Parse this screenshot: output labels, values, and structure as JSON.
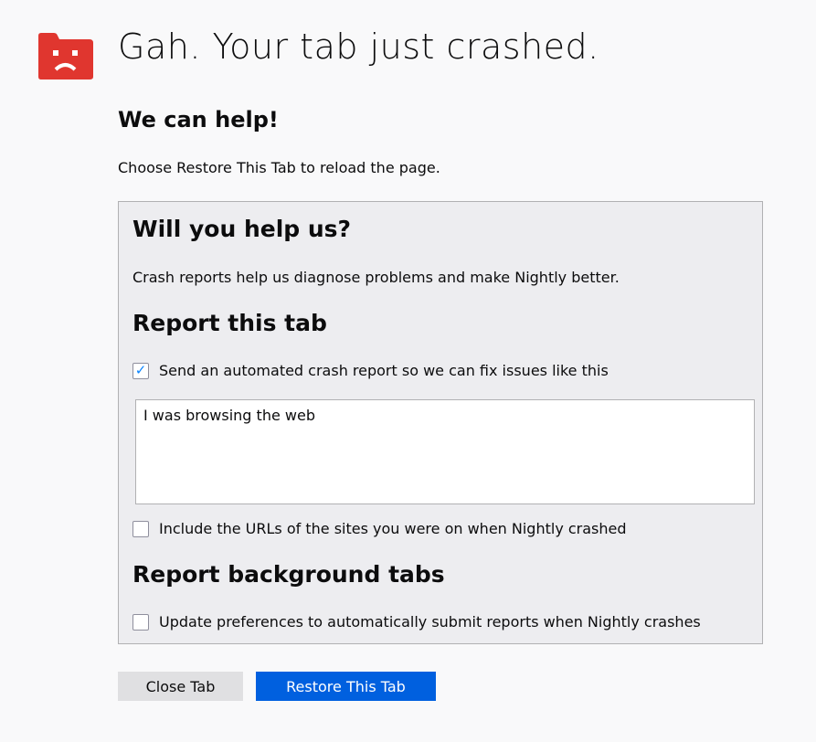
{
  "header": {
    "title": "Gah. Your tab just crashed.",
    "icon": "sad-tab-icon",
    "icon_color": "#e0362f"
  },
  "help": {
    "heading": "We can help!",
    "text": "Choose Restore This Tab to reload the page."
  },
  "report": {
    "heading": "Will you help us?",
    "text": "Crash reports help us diagnose problems and make Nightly better.",
    "report_tab_heading": "Report this tab",
    "send_report": {
      "label": "Send an automated crash report so we can fix issues like this",
      "checked": true
    },
    "comment": {
      "value": "I was browsing the web"
    },
    "include_urls": {
      "label": "Include the URLs of the sites you were on when Nightly crashed",
      "checked": false
    },
    "background_heading": "Report background tabs",
    "auto_submit": {
      "label": "Update preferences to automatically submit reports when Nightly crashes",
      "checked": false
    }
  },
  "buttons": {
    "close_label": "Close Tab",
    "restore_label": "Restore This Tab",
    "restore_color": "#0060df"
  }
}
